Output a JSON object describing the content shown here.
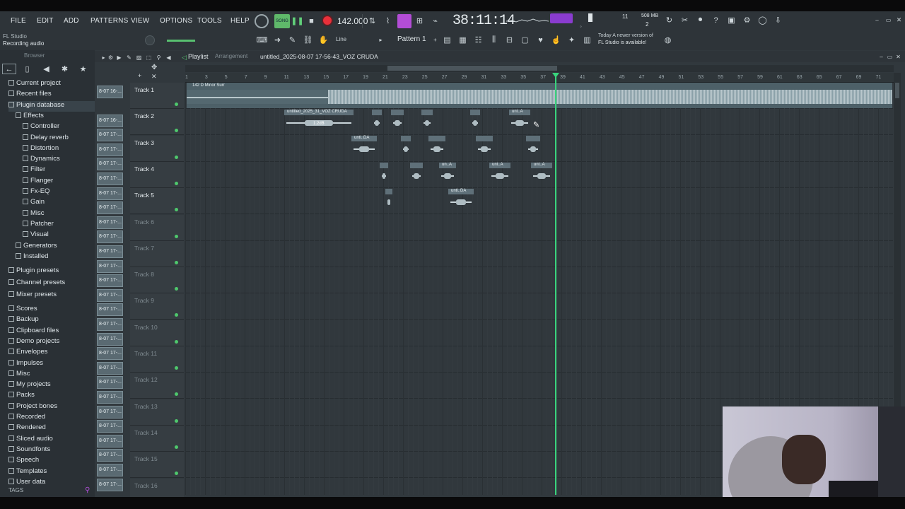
{
  "menu": [
    "FILE",
    "EDIT",
    "ADD",
    "PATTERNS",
    "VIEW",
    "OPTIONS",
    "TOOLS",
    "HELP"
  ],
  "transport": {
    "mode": "SONG",
    "tempo": "142.000",
    "time": "38:11:14",
    "tempo_sub": "⁻⁻⁻"
  },
  "meters": {
    "mem": "508 MB",
    "cpu": "11",
    "voices": "2"
  },
  "status": {
    "title": "FL Studio",
    "subtitle": "Recording audio"
  },
  "pattern": {
    "name": "Pattern 1",
    "snap": "Line"
  },
  "news": {
    "line1": "Today  A newer version of",
    "line2": "FL Studio is available!"
  },
  "browser": {
    "title": "Browser",
    "items": [
      {
        "label": "Current project",
        "level": 0
      },
      {
        "label": "Recent files",
        "level": 0
      },
      {
        "label": "Plugin database",
        "level": 0
      },
      {
        "label": "Effects",
        "level": 1
      },
      {
        "label": "Controller",
        "level": 2
      },
      {
        "label": "Delay reverb",
        "level": 2
      },
      {
        "label": "Distortion",
        "level": 2
      },
      {
        "label": "Dynamics",
        "level": 2
      },
      {
        "label": "Filter",
        "level": 2
      },
      {
        "label": "Flanger",
        "level": 2
      },
      {
        "label": "Fx-EQ",
        "level": 2
      },
      {
        "label": "Gain",
        "level": 2
      },
      {
        "label": "Misc",
        "level": 2
      },
      {
        "label": "Patcher",
        "level": 2
      },
      {
        "label": "Visual",
        "level": 2
      },
      {
        "label": "Generators",
        "level": 1
      },
      {
        "label": "Installed",
        "level": 1
      },
      {
        "label": "Plugin presets",
        "level": 0
      },
      {
        "label": "Channel presets",
        "level": 0
      },
      {
        "label": "Mixer presets",
        "level": 0
      },
      {
        "label": "Scores",
        "level": 0
      },
      {
        "label": "Backup",
        "level": 0
      },
      {
        "label": "Clipboard files",
        "level": 0
      },
      {
        "label": "Demo projects",
        "level": 0
      },
      {
        "label": "Envelopes",
        "level": 0
      },
      {
        "label": "Impulses",
        "level": 0
      },
      {
        "label": "Misc",
        "level": 0
      },
      {
        "label": "My projects",
        "level": 0
      },
      {
        "label": "Packs",
        "level": 0
      },
      {
        "label": "Project bones",
        "level": 0
      },
      {
        "label": "Recorded",
        "level": 0
      },
      {
        "label": "Rendered",
        "level": 0
      },
      {
        "label": "Sliced audio",
        "level": 0
      },
      {
        "label": "Soundfonts",
        "level": 0
      },
      {
        "label": "Speech",
        "level": 0
      },
      {
        "label": "Templates",
        "level": 0
      },
      {
        "label": "User data",
        "level": 0
      }
    ],
    "tags": "TAGS"
  },
  "playlist": {
    "title": "Playlist",
    "sub": "Arrangement",
    "project": "untitled_2025-08-07 17-56-43_VOZ CRUDA",
    "tracks": [
      "Track 1",
      "Track 2",
      "Track 3",
      "Track 4",
      "Track 5",
      "Track 6",
      "Track 7",
      "Track 8",
      "Track 9",
      "Track 10",
      "Track 11",
      "Track 12",
      "Track 13",
      "Track 14",
      "Track 15",
      "Track 16"
    ],
    "clip_labels": [
      "8-07 16-...",
      "8-07 16-...",
      "8-07 17-...",
      "8-07 17-...",
      "8-07 17-...",
      "8-07 17-...",
      "8-07 17-...",
      "8-07 17-...",
      "8-07 17-...",
      "8-07 17-...",
      "8-07 17-...",
      "8-07 17-...",
      "8-07 17-...",
      "8-07 17-...",
      "8-07 17-...",
      "8-07 17-...",
      "8-07 17-...",
      "8-07 17-...",
      "8-07 17-...",
      "8-07 17-...",
      "8-07 17-...",
      "8-07 17-...",
      "8-07 17-...",
      "8-07 17-...",
      "8-07 17-...",
      "8-07 17-...",
      "8-07 17-..."
    ],
    "ruler": [
      "1",
      "3",
      "5",
      "7",
      "9",
      "11",
      "13",
      "15",
      "17",
      "19",
      "21",
      "23",
      "25",
      "27",
      "29",
      "31",
      "33",
      "35",
      "37",
      "39",
      "41",
      "43",
      "45",
      "47",
      "49",
      "51",
      "53",
      "55",
      "57",
      "59",
      "61",
      "63",
      "65",
      "67",
      "69",
      "71"
    ],
    "beat_clip": "142 D Minor Surr",
    "clip_main": "untitled_2025_31_VOZ CRUDA",
    "clip_short": "unti..DA",
    "clip_a": "unt..A",
    "clip_un": "un..A",
    "gain": "1.2dB"
  }
}
